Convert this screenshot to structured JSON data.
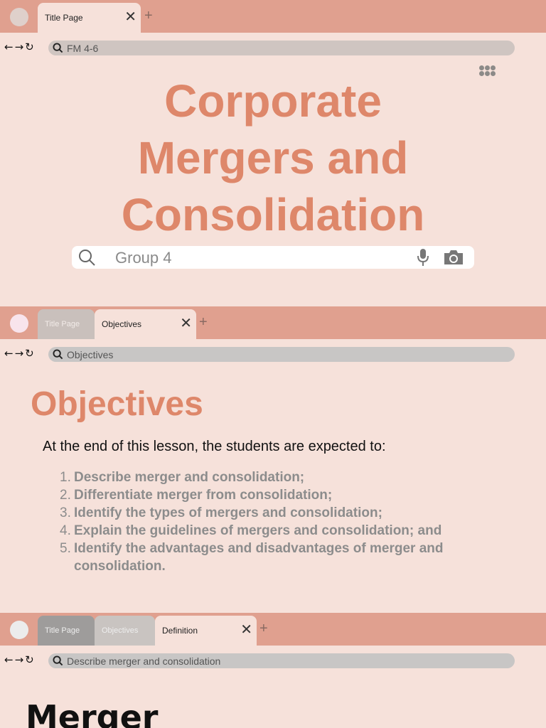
{
  "slides": [
    {
      "tabs": [
        {
          "label": "Title Page"
        }
      ],
      "url": "FM 4-6",
      "title_lines": [
        "Corporate",
        "Mergers and",
        "Consolidation"
      ],
      "search_text": "Group 4"
    },
    {
      "tabs": [
        {
          "label": "Title Page"
        },
        {
          "label": "Objectives"
        }
      ],
      "url": "Objectives",
      "heading": "Objectives",
      "intro": "At the end of this lesson, the students are expected to:",
      "items": [
        {
          "num": "1.",
          "text": "Describe merger and consolidation;"
        },
        {
          "num": "2.",
          "text": "Differentiate merger from consolidation;"
        },
        {
          "num": "3.",
          "text": "Identify the types of mergers and consolidation;"
        },
        {
          "num": "4.",
          "text": "Explain the guidelines of mergers and consolidation; and"
        },
        {
          "num": "5.",
          "text": "Identify the advantages and disadvantages of merger and consolidation."
        }
      ]
    },
    {
      "tabs": [
        {
          "label": "Title Page"
        },
        {
          "label": "Objectives"
        },
        {
          "label": "Definition"
        }
      ],
      "url": "Describe merger and consolidation",
      "heading": "Merger"
    }
  ],
  "icons": {
    "back": "arrow-left-icon",
    "forward": "arrow-right-icon",
    "reload": "reload-icon",
    "search": "search-icon",
    "close": "close-icon",
    "add": "plus-icon",
    "apps": "apps-grid-icon",
    "mic": "microphone-icon",
    "camera": "camera-icon"
  },
  "colors": {
    "background": "#f6e1da",
    "tabbar": "#e0a08f",
    "accent": "#de876a"
  }
}
